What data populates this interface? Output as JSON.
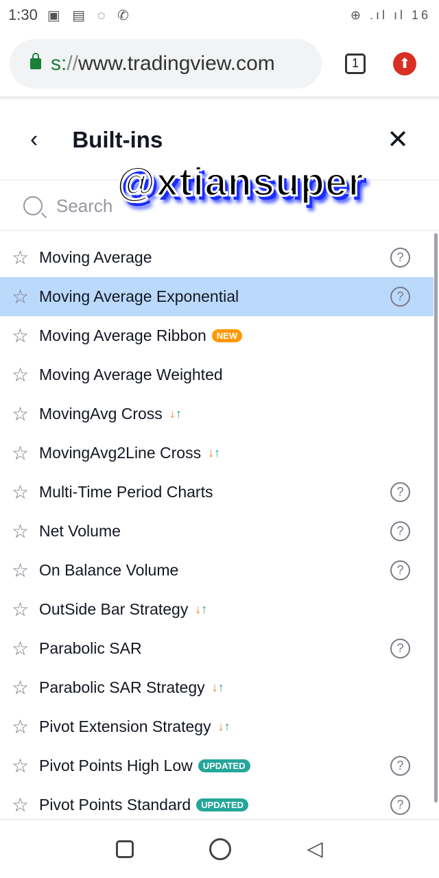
{
  "status_bar": {
    "time": "1:30",
    "notif_icons": "▣ ▤ ◌ ✆",
    "right": "⊕ .ıl ıl 16"
  },
  "browser": {
    "url_scheme": "s:",
    "url_slashes": "//",
    "url_host": "www.tradingview.com",
    "tab_count": "1"
  },
  "header": {
    "title": "Built-ins",
    "back": "‹",
    "close": "✕"
  },
  "search": {
    "placeholder": "Search"
  },
  "watermark": "@xtiansuper",
  "colors": {
    "selected": "#bbd9fb",
    "new_badge": "#ff9800",
    "updated_badge": "#26a69a"
  },
  "items": [
    {
      "name": "Moving Average",
      "help": true
    },
    {
      "name": "Moving Average Exponential",
      "help": true,
      "selected": true
    },
    {
      "name": "Moving Average Ribbon",
      "badge": "NEW"
    },
    {
      "name": "Moving Average Weighted"
    },
    {
      "name": "MovingAvg Cross",
      "strategy": true
    },
    {
      "name": "MovingAvg2Line Cross",
      "strategy": true
    },
    {
      "name": "Multi-Time Period Charts",
      "help": true
    },
    {
      "name": "Net Volume",
      "help": true
    },
    {
      "name": "On Balance Volume",
      "help": true
    },
    {
      "name": "OutSide Bar Strategy",
      "strategy": true
    },
    {
      "name": "Parabolic SAR",
      "help": true
    },
    {
      "name": "Parabolic SAR Strategy",
      "strategy": true
    },
    {
      "name": "Pivot Extension Strategy",
      "strategy": true
    },
    {
      "name": "Pivot Points High Low",
      "badge": "UPDATED",
      "help": true
    },
    {
      "name": "Pivot Points Standard",
      "badge": "UPDATED",
      "help": true
    }
  ]
}
